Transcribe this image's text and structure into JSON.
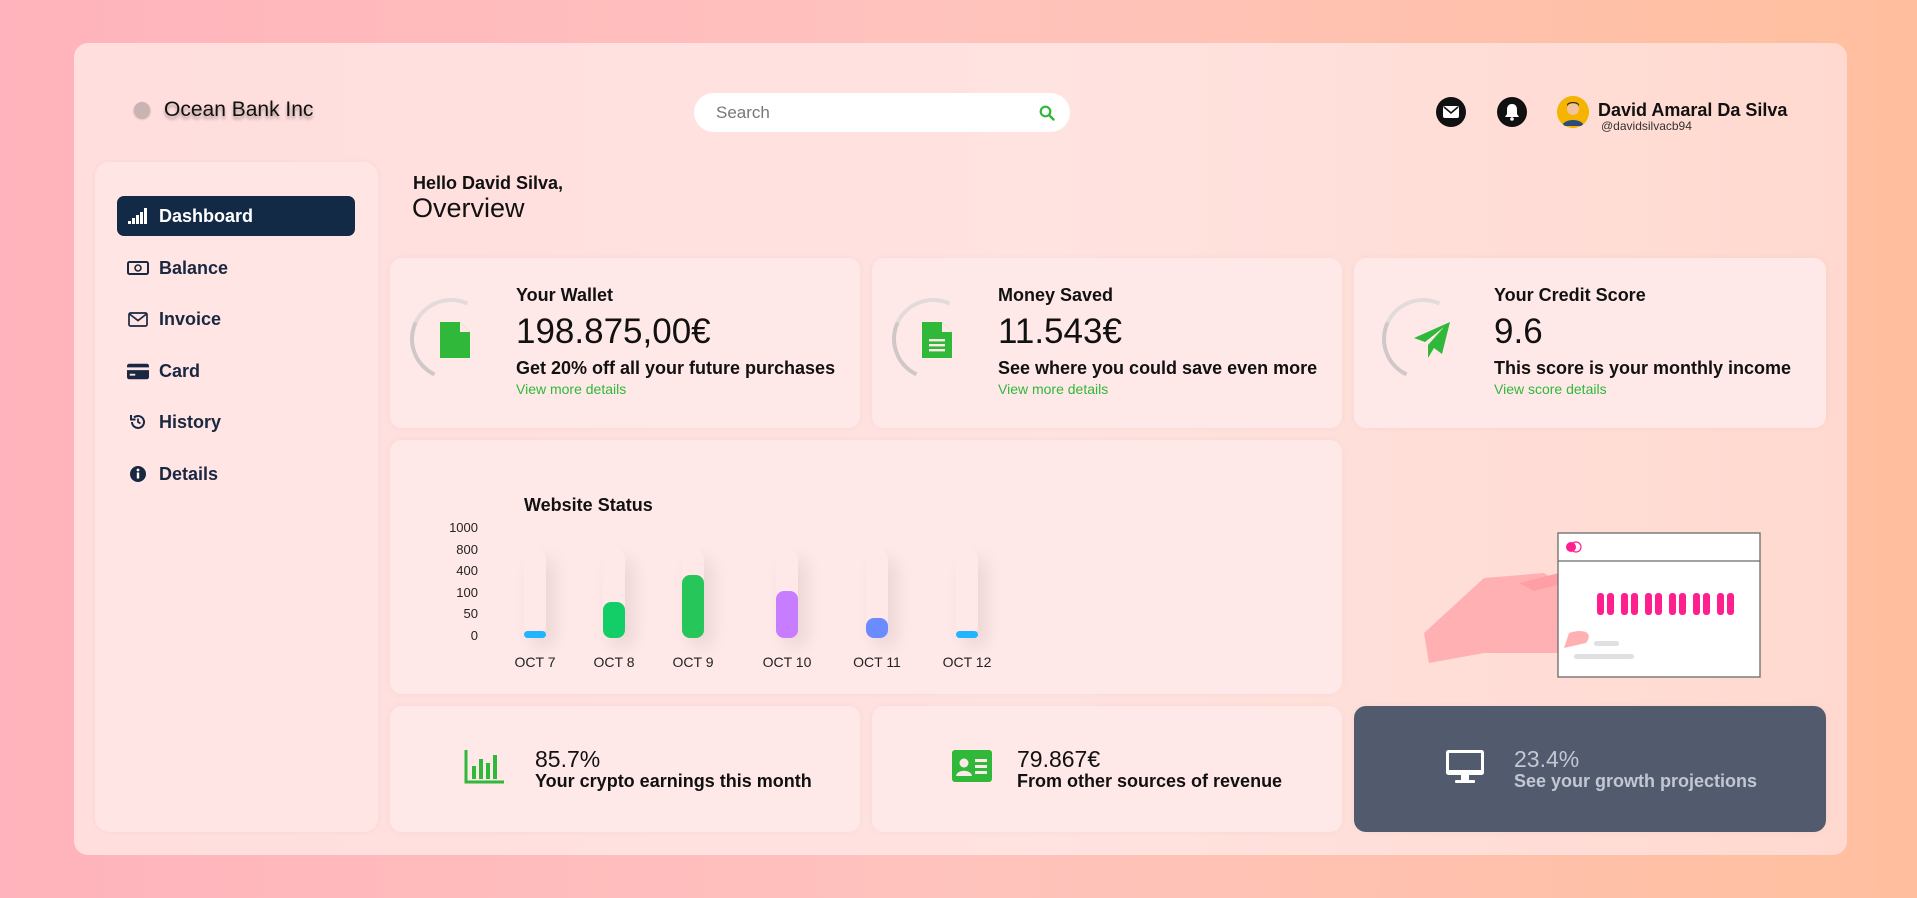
{
  "brand": {
    "name": "Ocean Bank Inc"
  },
  "search": {
    "placeholder": "Search"
  },
  "user": {
    "name": "David Amaral Da Silva",
    "handle": "@davidsilvacb94"
  },
  "sidebar": {
    "items": [
      {
        "label": "Dashboard",
        "icon": "signal-bars-icon",
        "active": true
      },
      {
        "label": "Balance",
        "icon": "money-bill-icon"
      },
      {
        "label": "Invoice",
        "icon": "envelope-icon"
      },
      {
        "label": "Card",
        "icon": "credit-card-icon"
      },
      {
        "label": "History",
        "icon": "history-icon"
      },
      {
        "label": "Details",
        "icon": "info-circle-icon"
      }
    ]
  },
  "greeting": {
    "hello": "Hello David Silva,",
    "title": "Overview"
  },
  "stats": [
    {
      "title": "Your Wallet",
      "value": "198.875,00€",
      "desc": "Get 20% off all your future purchases",
      "link": "View more details",
      "icon": "file-icon"
    },
    {
      "title": "Money Saved",
      "value": "11.543€",
      "desc": "See where you could save even more",
      "link": "View more details",
      "icon": "file-text-icon"
    },
    {
      "title": "Your Credit Score",
      "value": "9.6",
      "desc": "This score is your monthly income",
      "link": "View score details",
      "icon": "paper-plane-icon"
    }
  ],
  "chart_data": {
    "type": "bar",
    "title": "Website Status",
    "y_ticks": [
      "1000",
      "800",
      "400",
      "100",
      "50",
      "0"
    ],
    "categories": [
      "OCT 7",
      "OCT 8",
      "OCT 9",
      "OCT 10",
      "OCT 11",
      "OCT 12"
    ],
    "values": [
      0.08,
      0.4,
      0.7,
      0.52,
      0.22,
      0.08
    ],
    "colors": [
      "#1fb6ff",
      "#13ce66",
      "#26c65a",
      "#c77dff",
      "#6b8cff",
      "#1fb6ff"
    ]
  },
  "bottom": [
    {
      "value": "85.7%",
      "desc": "Your crypto earnings this month",
      "icon": "bar-chart-icon"
    },
    {
      "value": "79.867€",
      "desc": "From other sources of revenue",
      "icon": "id-card-icon"
    },
    {
      "value": "23.4%",
      "desc": "See your growth projections",
      "icon": "desktop-icon"
    }
  ],
  "colors": {
    "accent": "#2fb83a",
    "nav_active": "#132a46",
    "dark_card": "#525a6e",
    "pink": "#ff1f8f"
  }
}
